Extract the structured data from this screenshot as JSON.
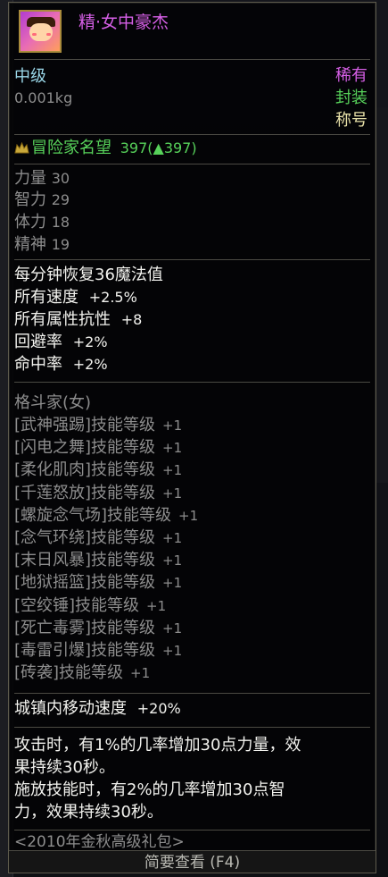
{
  "item": {
    "name": "精·女中豪杰",
    "grade": "中级",
    "weight": "0.001kg",
    "rarity": "稀有",
    "binding": "封装",
    "type": "称号"
  },
  "reputation": {
    "label": "冒险家名望",
    "value": "397(▲397)"
  },
  "stats": [
    {
      "name": "力量",
      "value": "30"
    },
    {
      "name": "智力",
      "value": "29"
    },
    {
      "name": "体力",
      "value": "18"
    },
    {
      "name": "精神",
      "value": "19"
    }
  ],
  "effects": [
    {
      "label": "每分钟恢复36魔法值",
      "value": ""
    },
    {
      "label": "所有速度",
      "value": "+2.5%"
    },
    {
      "label": "所有属性抗性",
      "value": "+8"
    },
    {
      "label": "回避率",
      "value": "+2%"
    },
    {
      "label": "命中率",
      "value": "+2%"
    }
  ],
  "class_header": "格斗家(女)",
  "skills": [
    {
      "label": "[武神强踢]技能等级",
      "value": "+1"
    },
    {
      "label": "[闪电之舞]技能等级",
      "value": "+1"
    },
    {
      "label": "[柔化肌肉]技能等级",
      "value": "+1"
    },
    {
      "label": "[千莲怒放]技能等级",
      "value": "+1"
    },
    {
      "label": "[螺旋念气场]技能等级",
      "value": "+1"
    },
    {
      "label": "[念气环绕]技能等级",
      "value": "+1"
    },
    {
      "label": "[末日风暴]技能等级",
      "value": "+1"
    },
    {
      "label": "[地狱摇篮]技能等级",
      "value": "+1"
    },
    {
      "label": "[空绞锤]技能等级",
      "value": "+1"
    },
    {
      "label": "[死亡毒雾]技能等级",
      "value": "+1"
    },
    {
      "label": "[毒雷引爆]技能等级",
      "value": "+1"
    },
    {
      "label": "[砖袭]技能等级",
      "value": "+1"
    }
  ],
  "town_speed": {
    "label": "城镇内移动速度",
    "value": "+20%"
  },
  "proc_lines": [
    "攻击时，有1%的几率增加30点力量，效",
    "果持续30秒。",
    "施放技能时，有2%的几率增加30点智",
    "力，效果持续30秒。"
  ],
  "source": "<2010年金秋高级礼包>",
  "footer_hint": "简要查看 (F4)",
  "colors": {
    "name": "#d65fe6",
    "stat_text": "#8d8d8d",
    "effect_text": "#f2f2ee",
    "rarity_purple": "#d65fe6",
    "binding_green": "#57d25a",
    "reputation_green": "#57d25a"
  },
  "icons": {
    "avatar": "title-avatar-icon",
    "reputation": "crown-icon"
  }
}
